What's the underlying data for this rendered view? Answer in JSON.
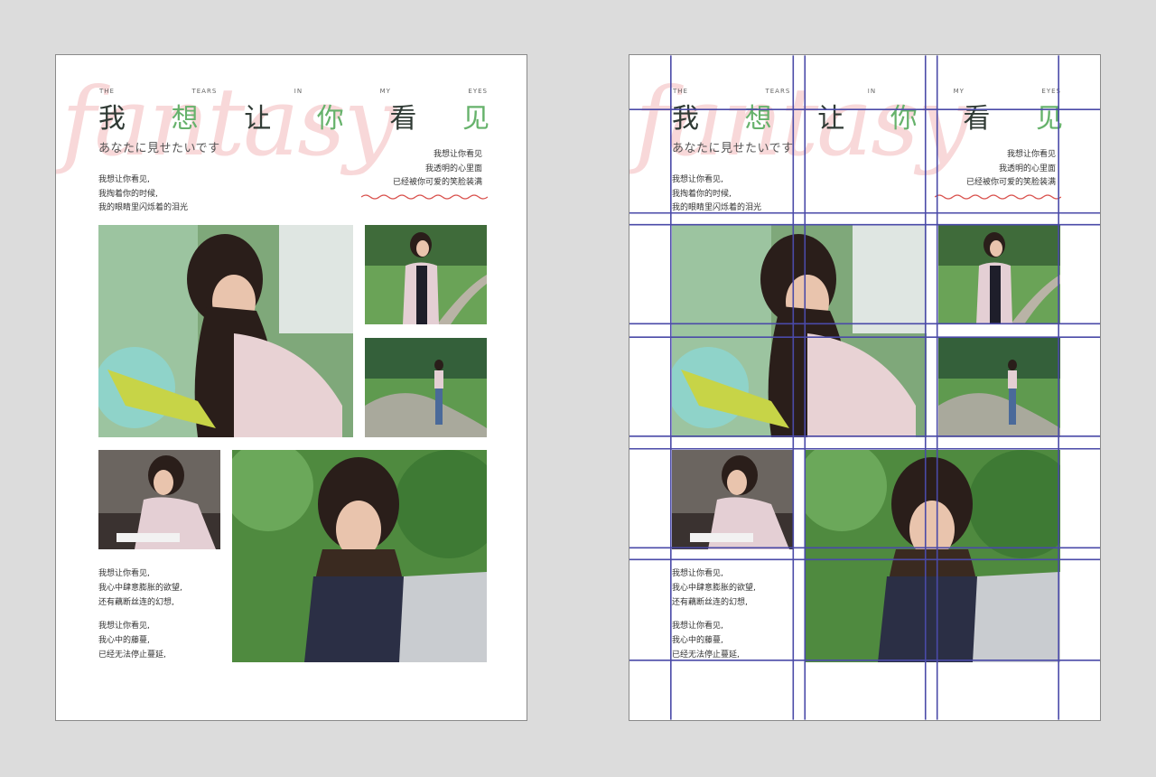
{
  "layout": {
    "eyebrow_words": [
      "THE",
      "TEARS",
      "IN",
      "MY",
      "EYES"
    ],
    "script_word": "fantasy",
    "title_chars": [
      "我",
      "想",
      "让",
      "你",
      "看",
      "见"
    ],
    "jp_subtitle": "あなたに見せたいです",
    "poem_right": [
      "我想让你看见",
      "我透明的心里面",
      "已经被你可爱的笑脸装满"
    ],
    "poem_left": [
      "我想让你看见,",
      "我掏着你的时候,",
      "我的眼睛里闪烁着的泪光"
    ],
    "poem_bottom_1": [
      "我想让你看见,",
      "我心中肆意膨胀的欲望,",
      "还有藕断丝连的幻想,"
    ],
    "poem_bottom_2": [
      "我想让你看见,",
      "我心中的藤蔓,",
      "已经无法停止蔓延,"
    ]
  },
  "colors": {
    "background": "#dcdcdc",
    "page": "#ffffff",
    "accent_green": "#66b26b",
    "script_pink": "#f8d8d9",
    "wave_red": "#d9534f",
    "grid_line": "#4a4aa8"
  },
  "pages": [
    {
      "name": "original-layout",
      "grid": false
    },
    {
      "name": "layout-with-grid",
      "grid": true
    }
  ]
}
